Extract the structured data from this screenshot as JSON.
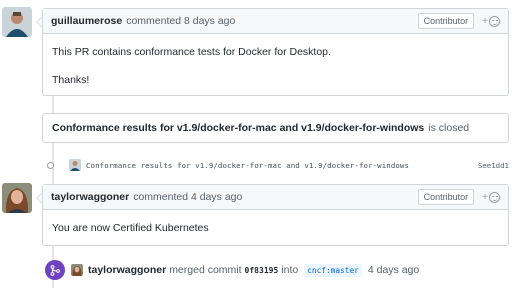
{
  "comments": [
    {
      "author": "guillaumerose",
      "meta": "commented 8 days ago",
      "role": "Contributor",
      "reaction": "+",
      "body": [
        "This PR contains conformance tests for Docker for Desktop.",
        "Thanks!"
      ]
    },
    {
      "author": "taylorwaggoner",
      "meta": "commented 4 days ago",
      "role": "Contributor",
      "reaction": "+",
      "body": [
        "You are now Certified Kubernetes"
      ]
    }
  ],
  "closed_reference": {
    "title": "Conformance results for v1.9/docker-for-mac and v1.9/docker-for-windows",
    "state": "is closed"
  },
  "commit": {
    "message": "Conformance results for v1.9/docker-for-mac and v1.9/docker-for-windows",
    "sha": "See1dd1"
  },
  "merge": {
    "author": "taylorwaggoner",
    "action": "merged commit",
    "sha": "0f83195",
    "into": "into",
    "branch": "cncf:master",
    "time": "4 days ago"
  },
  "colors": {
    "merge_purple": "#6f42c1",
    "header_bg": "#f6f8fa",
    "border": "#d1d5da",
    "branch_blue": "#0366d6"
  }
}
